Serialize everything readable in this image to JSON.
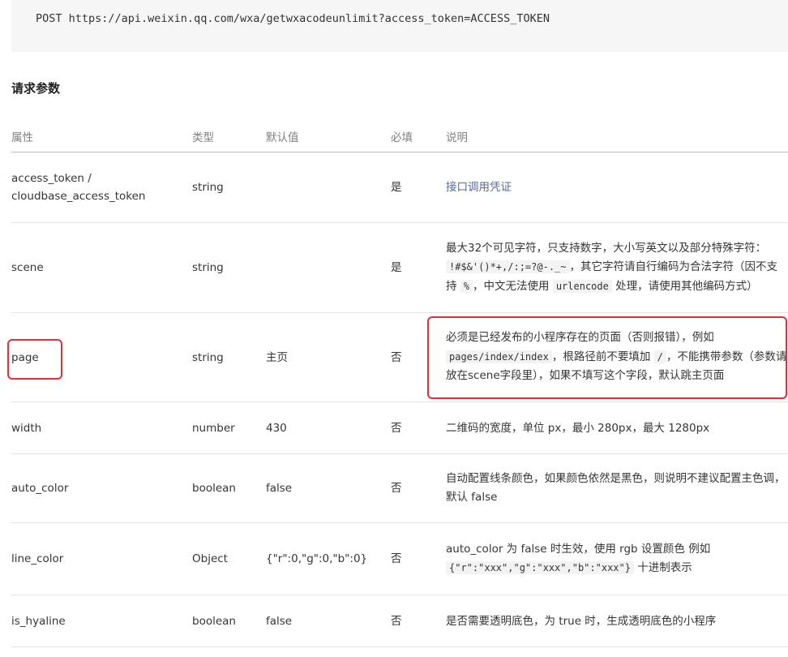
{
  "request_line": "POST https://api.weixin.qq.com/wxa/getwxacodeunlimit?access_token=ACCESS_TOKEN",
  "section_title": "请求参数",
  "headers": {
    "name": "属性",
    "type": "类型",
    "default": "默认值",
    "required": "必填",
    "desc": "说明"
  },
  "rows": [
    {
      "name_line1": "access_token /",
      "name_line2": "cloudbase_access_token",
      "type": "string",
      "default": "",
      "required": "是",
      "desc_link": "接口调用凭证"
    },
    {
      "name": "scene",
      "type": "string",
      "default": "",
      "required": "是",
      "desc_a": "最大32个可见字符，只支持数字，大小写英文以及部分特殊字符：",
      "desc_code1": "!#$&'()*+,/:;=?@-._~",
      "desc_b": "，其它字符请自行编码为合法字符（因不支持",
      "desc_code2": "%",
      "desc_c": "，中文无法使用",
      "desc_code3": "urlencode",
      "desc_d": "处理，请使用其他编码方式）"
    },
    {
      "name": "page",
      "type": "string",
      "default": "主页",
      "required": "否",
      "desc_a": "必须是已经发布的小程序存在的页面（否则报错），例如",
      "desc_code1": "pages/index/index",
      "desc_b": "，根路径前不要填加",
      "desc_code2": "/",
      "desc_c": "，不能携带参数（参数请放在scene字段里），如果不填写这个字段，默认跳主页面"
    },
    {
      "name": "width",
      "type": "number",
      "default": "430",
      "required": "否",
      "desc": "二维码的宽度，单位 px，最小 280px，最大 1280px"
    },
    {
      "name": "auto_color",
      "type": "boolean",
      "default": "false",
      "required": "否",
      "desc": "自动配置线条颜色，如果颜色依然是黑色，则说明不建议配置主色调，默认 false"
    },
    {
      "name": "line_color",
      "type": "Object",
      "default": "{\"r\":0,\"g\":0,\"b\":0}",
      "required": "否",
      "desc_a": "auto_color 为 false 时生效，使用 rgb 设置颜色 例如",
      "desc_code1": "{\"r\":\"xxx\",\"g\":\"xxx\",\"b\":\"xxx\"}",
      "desc_b": "十进制表示"
    },
    {
      "name": "is_hyaline",
      "type": "boolean",
      "default": "false",
      "required": "否",
      "desc": "是否需要透明底色，为 true 时，生成透明底色的小程序"
    }
  ],
  "colors": {
    "highlight": "#e0303a",
    "link": "#576b95",
    "code_bg": "#f6f6f6"
  }
}
